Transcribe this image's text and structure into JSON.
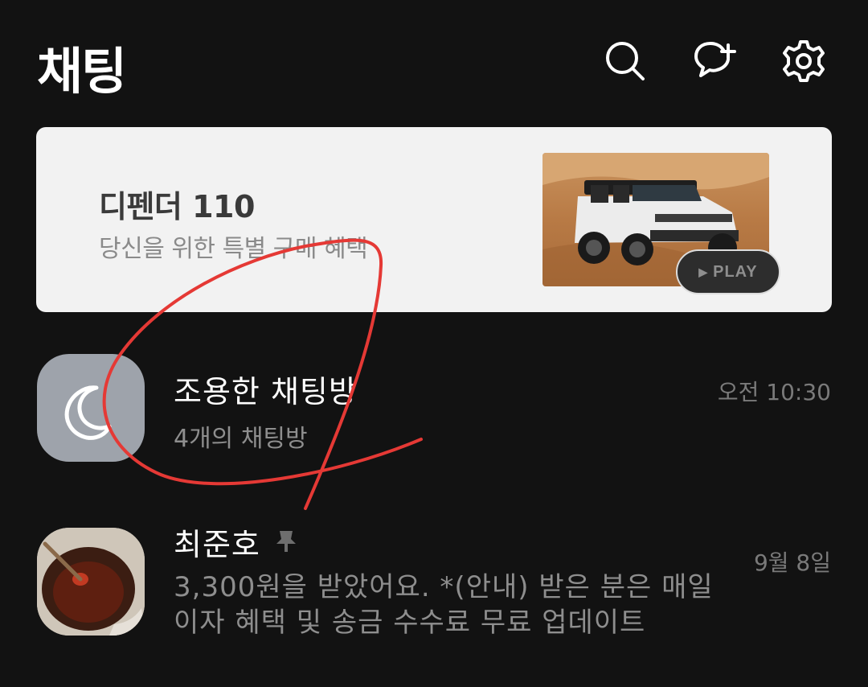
{
  "header": {
    "title": "채팅",
    "icons": [
      "search-icon",
      "new-chat-icon",
      "settings-icon"
    ]
  },
  "banner": {
    "title": "디펜더 110",
    "subtitle": "당신을 위한 특별 구매 혜택",
    "play_label": "PLAY"
  },
  "chats": [
    {
      "name": "조용한 채팅방",
      "subtitle": "4개의 채팅방",
      "time": "오전 10:30",
      "icon": "moon-icon"
    },
    {
      "name": "최준호",
      "pinned": true,
      "time": "9월 8일",
      "message_line1": "3,300원을 받았어요. *(안내) 받은 분은 매일",
      "message_line2": "이자 혜택 및 송금 수수료 무료 업데이트"
    }
  ],
  "colors": {
    "background": "#121212",
    "banner_bg": "#f2f2f2",
    "muted_text": "#8e8e8e",
    "scribble": "#e53935"
  }
}
